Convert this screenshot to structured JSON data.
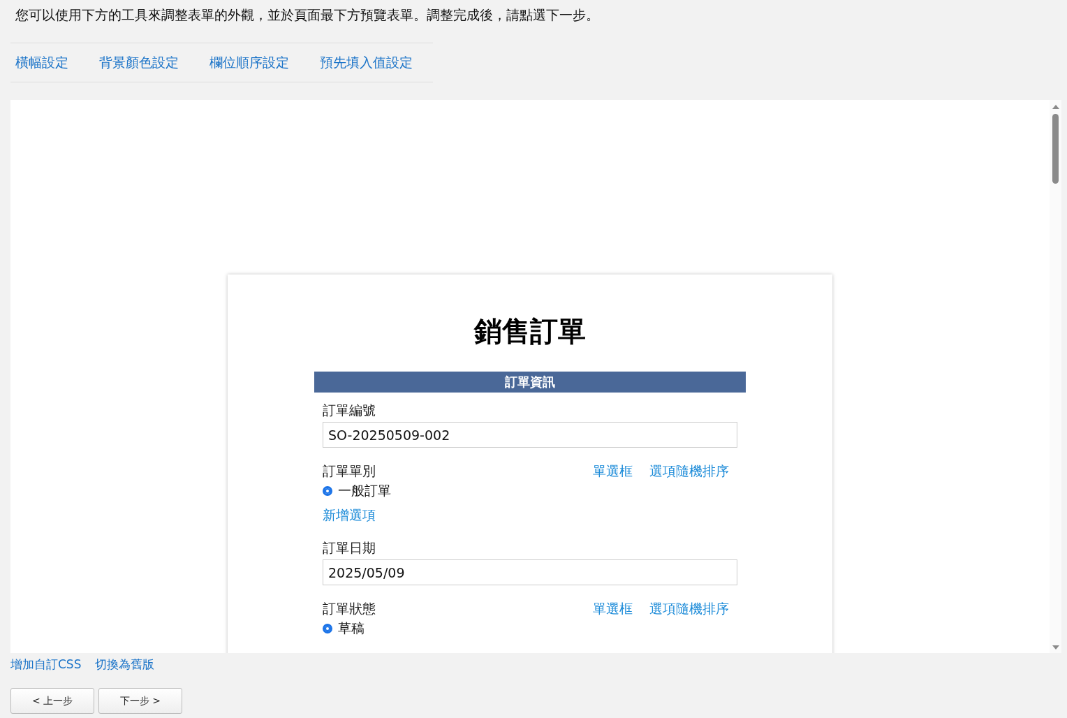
{
  "instruction": "您可以使用下方的工具來調整表單的外觀，並於頁面最下方預覽表單。調整完成後，請點選下一步。",
  "tabs": [
    "橫幅設定",
    "背景顏色設定",
    "欄位順序設定",
    "預先填入值設定"
  ],
  "preview": {
    "form_title": "銷售訂單",
    "section": "訂單資訊",
    "fields": [
      {
        "kind": "text",
        "label": "訂單編號",
        "value": "SO-20250509-002"
      },
      {
        "kind": "radio",
        "label": "訂單單別",
        "actions": [
          "單選框",
          "選項隨機排序"
        ],
        "options": [
          {
            "label": "一般訂單",
            "selected": true
          }
        ],
        "add_option": "新增選項"
      },
      {
        "kind": "text",
        "label": "訂單日期",
        "value": "2025/05/09"
      },
      {
        "kind": "radio",
        "label": "訂單狀態",
        "actions": [
          "單選框",
          "選項隨機排序"
        ],
        "options": [
          {
            "label": "草稿",
            "selected": true
          }
        ]
      }
    ]
  },
  "footer_links": [
    "增加自訂CSS",
    "切換為舊版"
  ],
  "buttons": [
    "< 上一步",
    "下一步 >"
  ]
}
